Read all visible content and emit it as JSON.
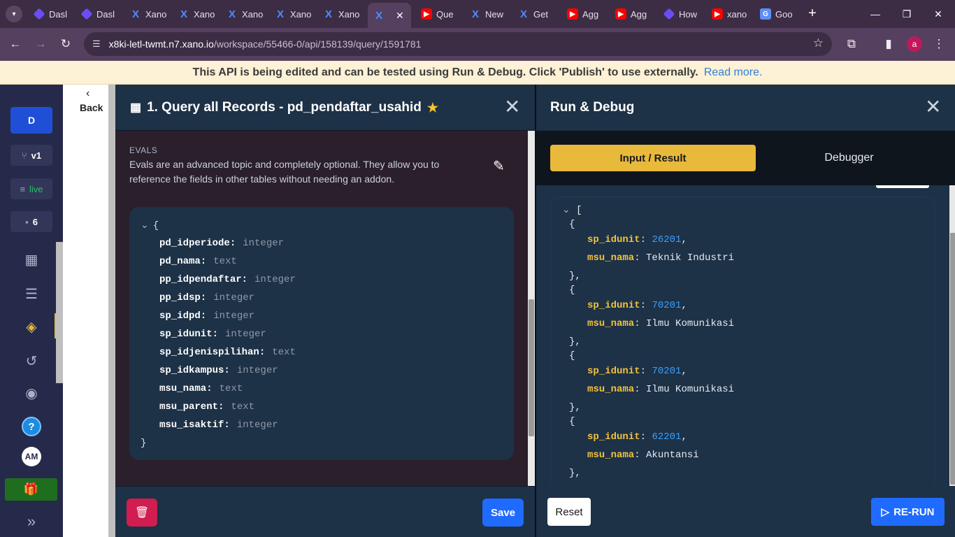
{
  "browser": {
    "tabs": [
      {
        "label": "Dasl",
        "icon": "xano-dashboard-icon"
      },
      {
        "label": "Dasl",
        "icon": "xano-dashboard-icon"
      },
      {
        "label": "Xano",
        "icon": "xano-icon"
      },
      {
        "label": "Xano",
        "icon": "xano-icon"
      },
      {
        "label": "Xano",
        "icon": "xano-icon"
      },
      {
        "label": "Xano",
        "icon": "xano-icon"
      },
      {
        "label": "Xano",
        "icon": "xano-icon"
      },
      {
        "label": "",
        "icon": "xano-icon",
        "active": true
      },
      {
        "label": "Que",
        "icon": "youtube-icon"
      },
      {
        "label": "New",
        "icon": "xano-icon"
      },
      {
        "label": "Get",
        "icon": "xano-icon"
      },
      {
        "label": "Agg",
        "icon": "youtube-icon"
      },
      {
        "label": "Agg",
        "icon": "youtube-icon"
      },
      {
        "label": "How",
        "icon": "xano-dashboard-icon"
      },
      {
        "label": "xano",
        "icon": "youtube-icon"
      },
      {
        "label": "Goo",
        "icon": "google-translate-icon"
      }
    ],
    "url_host": "x8ki-letl-twmt.n7.xano.io",
    "url_path": "/workspace/55466-0/api/158139/query/1591781",
    "profile_initial": "a"
  },
  "banner": {
    "message": "This API is being edited and can be tested using Run & Debug. Click 'Publish' to use externally.",
    "link": "Read more."
  },
  "appnav": {
    "workspace_initial": "D",
    "branch": "v1",
    "status": "live",
    "comments_count": "6",
    "user_initials": "AM"
  },
  "back": {
    "label": "Back"
  },
  "function_panel": {
    "title": "1.  Query all Records - pd_pendaftar_usahid",
    "evals_heading": "EVALS",
    "evals_description": "Evals are an advanced topic and completely optional. They allow you to reference the fields in other tables without needing an addon.",
    "schema_open": "{",
    "schema_close": "}",
    "fields": [
      {
        "name": "pd_idperiode:",
        "type": "integer"
      },
      {
        "name": "pd_nama:",
        "type": "text"
      },
      {
        "name": "pp_idpendaftar:",
        "type": "integer"
      },
      {
        "name": "pp_idsp:",
        "type": "integer"
      },
      {
        "name": "sp_idpd:",
        "type": "integer"
      },
      {
        "name": "sp_idunit:",
        "type": "integer"
      },
      {
        "name": "sp_idjenispilihan:",
        "type": "text"
      },
      {
        "name": "sp_idkampus:",
        "type": "integer"
      },
      {
        "name": "msu_nama:",
        "type": "text"
      },
      {
        "name": "msu_parent:",
        "type": "text"
      },
      {
        "name": "msu_isaktif:",
        "type": "integer"
      }
    ],
    "save_label": "Save"
  },
  "run_debug": {
    "title": "Run & Debug",
    "tab_input": "Input / Result",
    "tab_debugger": "Debugger",
    "records": [
      {
        "sp_idunit": "26201",
        "msu_nama": "Teknik Industri"
      },
      {
        "sp_idunit": "70201",
        "msu_nama": "Ilmu Komunikasi"
      },
      {
        "sp_idunit": "70201",
        "msu_nama": "Ilmu Komunikasi"
      },
      {
        "sp_idunit": "62201",
        "msu_nama": "Akuntansi"
      }
    ],
    "reset_label": "Reset",
    "rerun_label": "RE-RUN"
  },
  "colors": {
    "accent_blue": "#1f6bff",
    "accent_yellow": "#e8b93a",
    "danger": "#d11d4f",
    "panel": "#1d3147"
  }
}
